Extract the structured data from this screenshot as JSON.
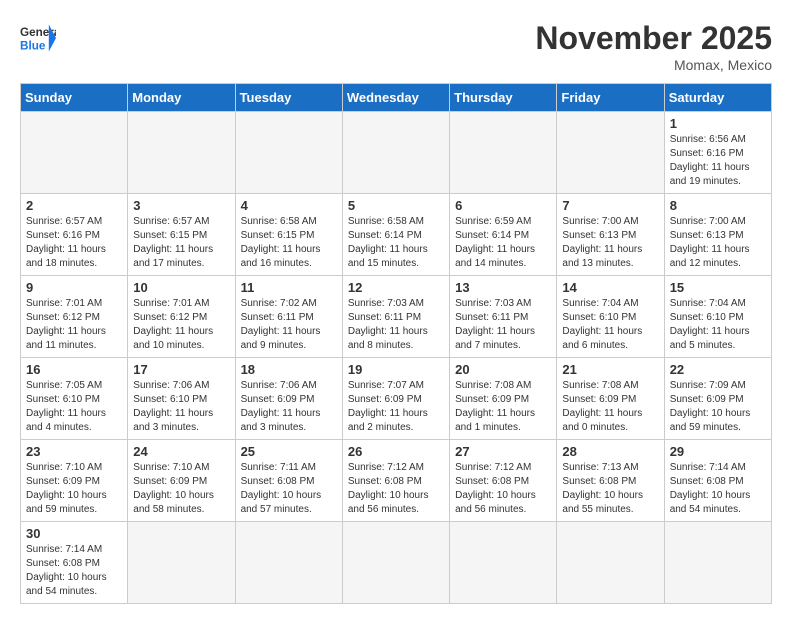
{
  "header": {
    "logo_general": "General",
    "logo_blue": "Blue",
    "month_title": "November 2025",
    "location": "Momax, Mexico"
  },
  "days_of_week": [
    "Sunday",
    "Monday",
    "Tuesday",
    "Wednesday",
    "Thursday",
    "Friday",
    "Saturday"
  ],
  "weeks": [
    [
      null,
      null,
      null,
      null,
      null,
      null,
      {
        "day": "1",
        "sunrise": "6:56 AM",
        "sunset": "6:16 PM",
        "daylight_hours": "11",
        "daylight_minutes": "19"
      }
    ],
    [
      {
        "day": "2",
        "sunrise": "6:57 AM",
        "sunset": "6:16 PM",
        "daylight_hours": "11",
        "daylight_minutes": "18"
      },
      {
        "day": "3",
        "sunrise": "6:57 AM",
        "sunset": "6:15 PM",
        "daylight_hours": "11",
        "daylight_minutes": "17"
      },
      {
        "day": "4",
        "sunrise": "6:58 AM",
        "sunset": "6:15 PM",
        "daylight_hours": "11",
        "daylight_minutes": "16"
      },
      {
        "day": "5",
        "sunrise": "6:58 AM",
        "sunset": "6:14 PM",
        "daylight_hours": "11",
        "daylight_minutes": "15"
      },
      {
        "day": "6",
        "sunrise": "6:59 AM",
        "sunset": "6:14 PM",
        "daylight_hours": "11",
        "daylight_minutes": "14"
      },
      {
        "day": "7",
        "sunrise": "7:00 AM",
        "sunset": "6:13 PM",
        "daylight_hours": "11",
        "daylight_minutes": "13"
      },
      {
        "day": "8",
        "sunrise": "7:00 AM",
        "sunset": "6:13 PM",
        "daylight_hours": "11",
        "daylight_minutes": "12"
      }
    ],
    [
      {
        "day": "9",
        "sunrise": "7:01 AM",
        "sunset": "6:12 PM",
        "daylight_hours": "11",
        "daylight_minutes": "11"
      },
      {
        "day": "10",
        "sunrise": "7:01 AM",
        "sunset": "6:12 PM",
        "daylight_hours": "11",
        "daylight_minutes": "10"
      },
      {
        "day": "11",
        "sunrise": "7:02 AM",
        "sunset": "6:11 PM",
        "daylight_hours": "11",
        "daylight_minutes": "9"
      },
      {
        "day": "12",
        "sunrise": "7:03 AM",
        "sunset": "6:11 PM",
        "daylight_hours": "11",
        "daylight_minutes": "8"
      },
      {
        "day": "13",
        "sunrise": "7:03 AM",
        "sunset": "6:11 PM",
        "daylight_hours": "11",
        "daylight_minutes": "7"
      },
      {
        "day": "14",
        "sunrise": "7:04 AM",
        "sunset": "6:10 PM",
        "daylight_hours": "11",
        "daylight_minutes": "6"
      },
      {
        "day": "15",
        "sunrise": "7:04 AM",
        "sunset": "6:10 PM",
        "daylight_hours": "11",
        "daylight_minutes": "5"
      }
    ],
    [
      {
        "day": "16",
        "sunrise": "7:05 AM",
        "sunset": "6:10 PM",
        "daylight_hours": "11",
        "daylight_minutes": "4"
      },
      {
        "day": "17",
        "sunrise": "7:06 AM",
        "sunset": "6:10 PM",
        "daylight_hours": "11",
        "daylight_minutes": "3"
      },
      {
        "day": "18",
        "sunrise": "7:06 AM",
        "sunset": "6:09 PM",
        "daylight_hours": "11",
        "daylight_minutes": "3"
      },
      {
        "day": "19",
        "sunrise": "7:07 AM",
        "sunset": "6:09 PM",
        "daylight_hours": "11",
        "daylight_minutes": "2"
      },
      {
        "day": "20",
        "sunrise": "7:08 AM",
        "sunset": "6:09 PM",
        "daylight_hours": "11",
        "daylight_minutes": "1"
      },
      {
        "day": "21",
        "sunrise": "7:08 AM",
        "sunset": "6:09 PM",
        "daylight_hours": "11",
        "daylight_minutes": "0"
      },
      {
        "day": "22",
        "sunrise": "7:09 AM",
        "sunset": "6:09 PM",
        "daylight_hours": "10",
        "daylight_minutes": "59"
      }
    ],
    [
      {
        "day": "23",
        "sunrise": "7:10 AM",
        "sunset": "6:09 PM",
        "daylight_hours": "10",
        "daylight_minutes": "59"
      },
      {
        "day": "24",
        "sunrise": "7:10 AM",
        "sunset": "6:09 PM",
        "daylight_hours": "10",
        "daylight_minutes": "58"
      },
      {
        "day": "25",
        "sunrise": "7:11 AM",
        "sunset": "6:08 PM",
        "daylight_hours": "10",
        "daylight_minutes": "57"
      },
      {
        "day": "26",
        "sunrise": "7:12 AM",
        "sunset": "6:08 PM",
        "daylight_hours": "10",
        "daylight_minutes": "56"
      },
      {
        "day": "27",
        "sunrise": "7:12 AM",
        "sunset": "6:08 PM",
        "daylight_hours": "10",
        "daylight_minutes": "56"
      },
      {
        "day": "28",
        "sunrise": "7:13 AM",
        "sunset": "6:08 PM",
        "daylight_hours": "10",
        "daylight_minutes": "55"
      },
      {
        "day": "29",
        "sunrise": "7:14 AM",
        "sunset": "6:08 PM",
        "daylight_hours": "10",
        "daylight_minutes": "54"
      }
    ],
    [
      {
        "day": "30",
        "sunrise": "7:14 AM",
        "sunset": "6:08 PM",
        "daylight_hours": "10",
        "daylight_minutes": "54"
      },
      null,
      null,
      null,
      null,
      null,
      null
    ]
  ]
}
